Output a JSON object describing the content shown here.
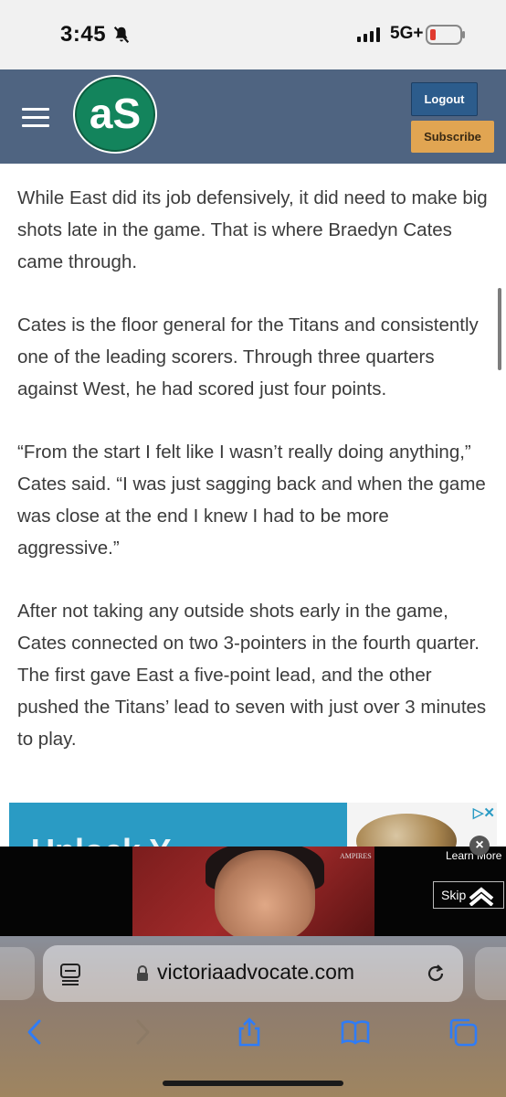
{
  "status_bar": {
    "time": "3:45",
    "network": "5G+",
    "icons": [
      "bell-slash-icon",
      "signal-icon",
      "battery-icon"
    ],
    "battery_color": "#e03a2f"
  },
  "header": {
    "logo_text": "aS",
    "logout_label": "Logout",
    "subscribe_label": "Subscribe",
    "colors": {
      "background": "#4f6481",
      "logout": "#2c5c8c",
      "subscribe": "#e1a552",
      "logo": "#13845c"
    }
  },
  "article": {
    "paragraphs": [
      "While East did its job defensively, it did need to make big shots late in the game. That is where Braedyn Cates came through.",
      "Cates is the floor general for the Titans and consistently one of the leading scorers. Through three quarters against West, he had scored just four points.",
      "“From the start I felt like I wasn’t really doing anything,” Cates said. “I was just sagging back and when the game was close at the end I knew I had to be more aggressive.”",
      "After not taking any outside shots early in the game, Cates connected on two 3-pointers in the fourth quarter. The first gave East a five-point lead, and the other pushed the Titans’ lead to seven with just over 3 minutes to play."
    ]
  },
  "ads": {
    "banner_partial_text": "Unlock Y",
    "video": {
      "learn_more": "Learn More",
      "skip_label": "Skip",
      "brand_text": "AMPIRES"
    }
  },
  "browser": {
    "url": "victoriaadvocate.com",
    "toolbar_icons": [
      "back-icon",
      "forward-icon",
      "share-icon",
      "bookmarks-icon",
      "tabs-icon"
    ]
  }
}
